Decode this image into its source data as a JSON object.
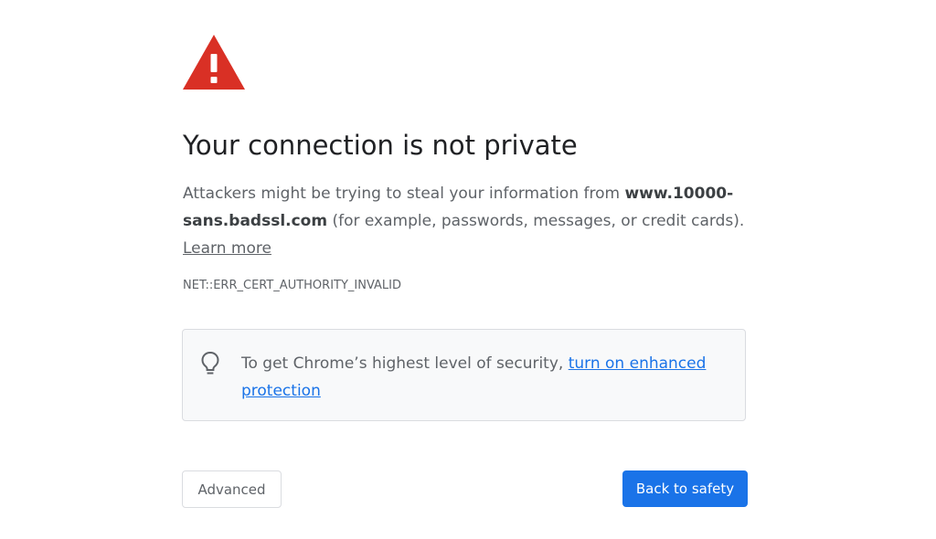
{
  "icons": {
    "warning": "warning-triangle-icon",
    "bulb": "lightbulb-icon"
  },
  "heading": "Your connection is not private",
  "description": {
    "prefix": "Attackers might be trying to steal your information from ",
    "host": "www.10000-sans.badssl.com",
    "suffix": " (for example, passwords, messages, or credit cards).",
    "learn_more": "Learn more"
  },
  "error_code": "NET::ERR_CERT_AUTHORITY_INVALID",
  "promo": {
    "text": "To get Chrome’s highest level of security, ",
    "link": "turn on enhanced protection"
  },
  "buttons": {
    "advanced": "Advanced",
    "back_to_safety": "Back to safety"
  },
  "colors": {
    "warning_red": "#d93025",
    "primary_blue": "#1a73e8",
    "text_secondary": "#5f6368",
    "promo_bg": "#f8f9fa"
  }
}
